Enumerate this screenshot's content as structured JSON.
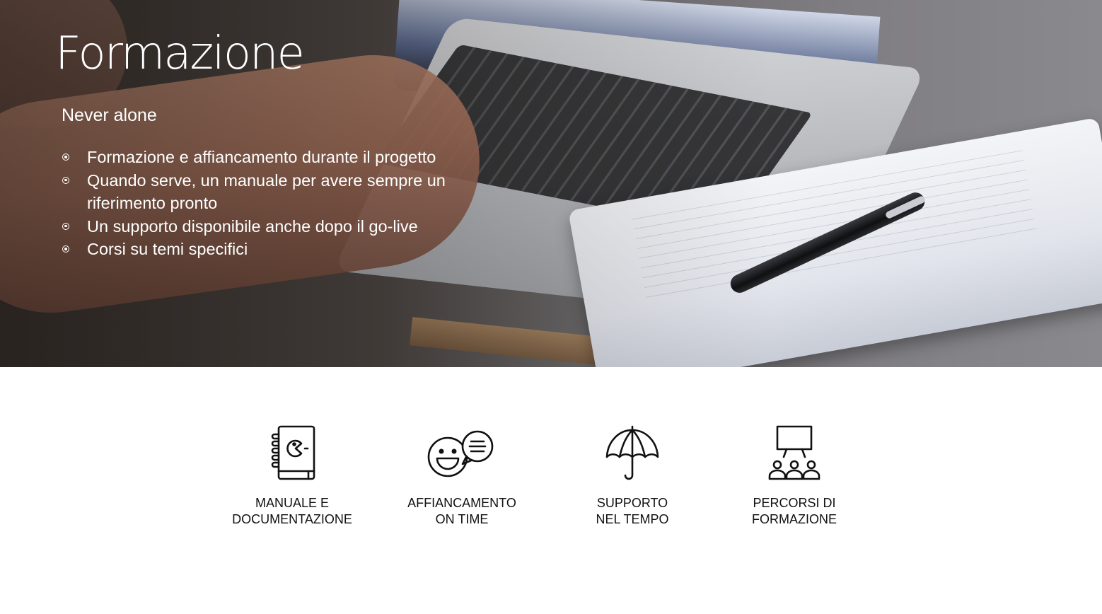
{
  "hero": {
    "title": "Formazione",
    "subtitle": "Never alone",
    "bullets": [
      "Formazione e affiancamento durante il progetto",
      "Quando serve, un manuale per avere sempre un riferimento pronto",
      "Un supporto disponibile anche dopo il go-live",
      "Corsi su temi specifici"
    ]
  },
  "features": [
    {
      "icon": "manual-book-icon",
      "label_line1": "MANUALE E",
      "label_line2": "DOCUMENTAZIONE"
    },
    {
      "icon": "smiley-chat-icon",
      "label_line1": "AFFIANCAMENTO",
      "label_line2": "ON TIME"
    },
    {
      "icon": "umbrella-icon",
      "label_line1": "SUPPORTO",
      "label_line2": "NEL TEMPO"
    },
    {
      "icon": "presentation-audience-icon",
      "label_line1": "PERCORSI DI",
      "label_line2": "FORMAZIONE"
    }
  ]
}
